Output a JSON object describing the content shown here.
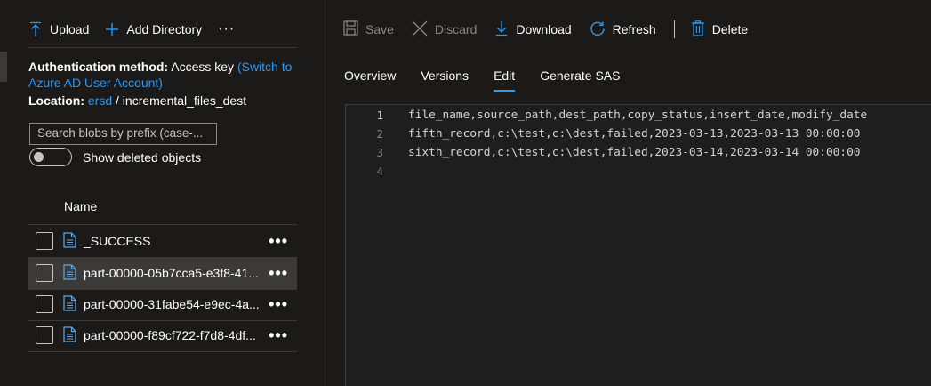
{
  "left_toolbar": {
    "upload_label": "Upload",
    "add_directory_label": "Add Directory",
    "more_label": "···"
  },
  "auth": {
    "method_label": "Authentication method:",
    "method_value": "Access key",
    "switch_link": "(Switch to Azure AD User Account)",
    "location_label": "Location:",
    "location_container": "ersd",
    "location_separator": "/",
    "location_folder": "incremental_files_dest"
  },
  "search": {
    "placeholder": "Search blobs by prefix (case-..."
  },
  "deleted_toggle": {
    "label": "Show deleted objects",
    "state": "off"
  },
  "list": {
    "column_name": "Name",
    "files": [
      {
        "name": "_SUCCESS",
        "selected": false
      },
      {
        "name": "part-00000-05b7cca5-e3f8-41...",
        "selected": true
      },
      {
        "name": "part-00000-31fabe54-e9ec-4a...",
        "selected": false
      },
      {
        "name": "part-00000-f89cf722-f7d8-4df...",
        "selected": false
      }
    ],
    "row_more_label": "•••"
  },
  "right_toolbar": {
    "save_label": "Save",
    "discard_label": "Discard",
    "download_label": "Download",
    "refresh_label": "Refresh",
    "delete_label": "Delete"
  },
  "tabs": [
    {
      "label": "Overview",
      "active": false
    },
    {
      "label": "Versions",
      "active": false
    },
    {
      "label": "Edit",
      "active": true
    },
    {
      "label": "Generate SAS",
      "active": false
    }
  ],
  "editor": {
    "lines": [
      {
        "number": "1",
        "text": "file_name,source_path,dest_path,copy_status,insert_date,modify_date"
      },
      {
        "number": "2",
        "text": "fifth_record,c:\\test,c:\\dest,failed,2023-03-13,2023-03-13 00:00:00"
      },
      {
        "number": "3",
        "text": "sixth_record,c:\\test,c:\\dest,failed,2023-03-14,2023-03-14 00:00:00"
      },
      {
        "number": "4",
        "text": ""
      }
    ]
  },
  "colors": {
    "background": "#1b1a19",
    "accent": "#2899f5",
    "selected_row": "#3b3a39",
    "editor_bg": "#1e1e1e"
  }
}
